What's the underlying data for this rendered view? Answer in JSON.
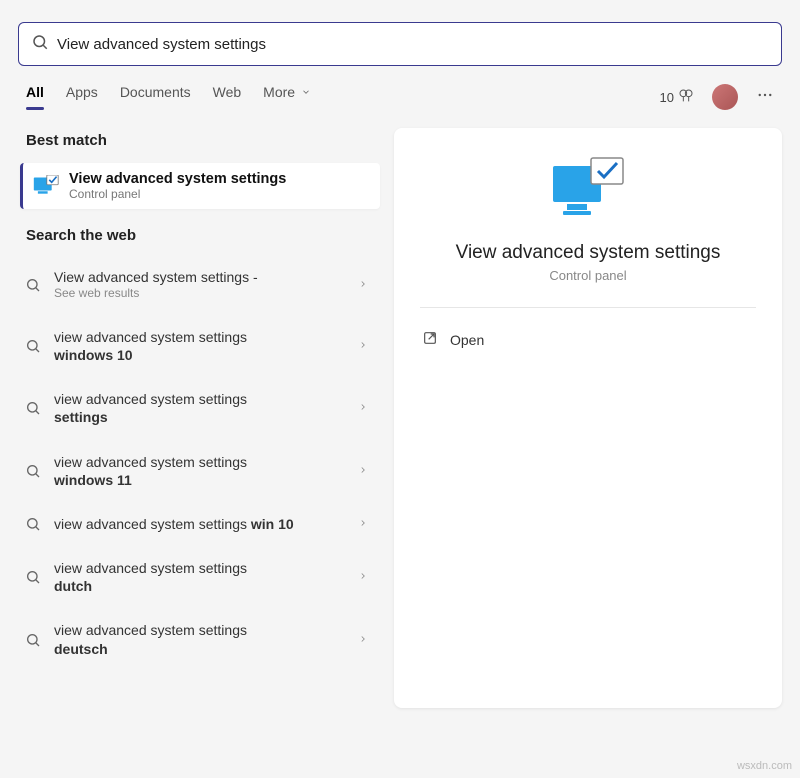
{
  "search": {
    "value": "View advanced system settings"
  },
  "tabs": [
    "All",
    "Apps",
    "Documents",
    "Web",
    "More"
  ],
  "active_tab": 0,
  "points": "10",
  "sections": {
    "best_match": "Best match",
    "search_web": "Search the web"
  },
  "best_match": {
    "title": "View advanced system settings",
    "subtitle": "Control panel"
  },
  "web_results": [
    {
      "line1": "View advanced system settings -",
      "line2_sub": "See web results"
    },
    {
      "line1": "view advanced system settings",
      "bold2": "windows 10"
    },
    {
      "line1": "view advanced system settings",
      "bold2": "settings"
    },
    {
      "line1": "view advanced system settings",
      "bold2": "windows 11"
    },
    {
      "line1": "view advanced system settings",
      "inline_bold": "win 10"
    },
    {
      "line1": "view advanced system settings",
      "bold2": "dutch"
    },
    {
      "line1": "view advanced system settings",
      "bold2": "deutsch"
    }
  ],
  "detail": {
    "title": "View advanced system settings",
    "subtitle": "Control panel",
    "actions": [
      {
        "label": "Open"
      }
    ]
  },
  "watermark": "wsxdn.com"
}
